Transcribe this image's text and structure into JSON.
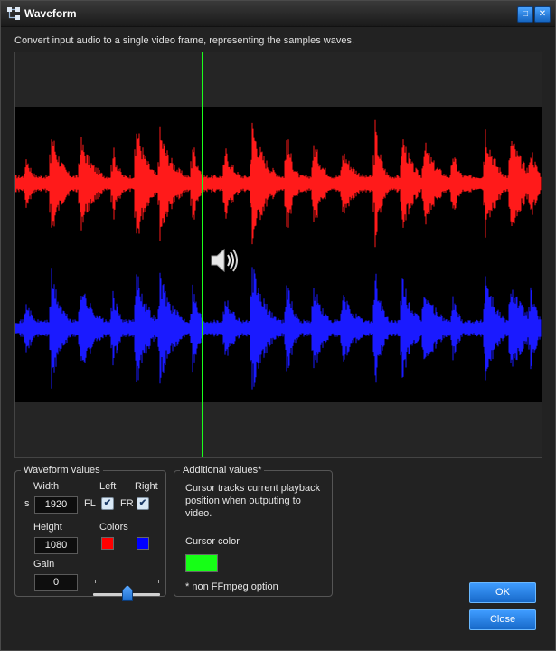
{
  "window": {
    "title": "Waveform"
  },
  "description": "Convert input audio to a single video frame, representing the samples waves.",
  "preview": {
    "top_channel_color": "#ff1a1a",
    "bottom_channel_color": "#1a1aff",
    "cursor_color": "#1aff1a",
    "speaker_icon": "speaker-icon"
  },
  "waveform_values": {
    "legend": "Waveform values",
    "width_label": "Width",
    "width_prefix": "s",
    "width_value": "1920",
    "height_label": "Height",
    "height_value": "1080",
    "gain_label": "Gain",
    "gain_value": "0",
    "left_label": "Left",
    "right_label": "Right",
    "fl_label": "FL",
    "fr_label": "FR",
    "left_checked": true,
    "right_checked": true,
    "colors_label": "Colors",
    "left_color": "#ff0000",
    "right_color": "#0000ff",
    "gain_slider_level": 0.52
  },
  "additional_values": {
    "legend": "Additional values*",
    "note": "Cursor tracks current playback position when outputing to video.",
    "note_line1": "Cursor tracks current playback",
    "note_line2": "position when outputing to",
    "note_line3": "video.",
    "cursor_color_label": "Cursor color",
    "cursor_color": "#16ff16",
    "footnote": "* non FFmpeg option"
  },
  "buttons": {
    "ok": "OK",
    "close": "Close"
  }
}
